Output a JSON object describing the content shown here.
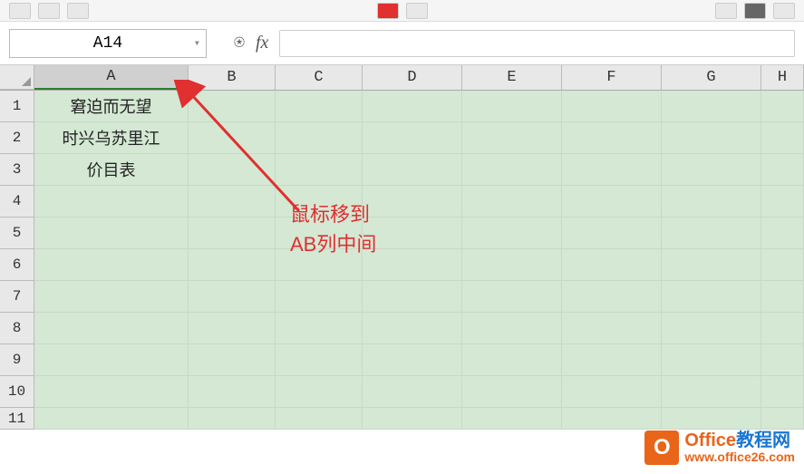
{
  "namebox": {
    "value": "A14"
  },
  "formula_bar": {
    "fx_label": "fx",
    "value": ""
  },
  "columns": [
    "A",
    "B",
    "C",
    "D",
    "E",
    "F",
    "G",
    "H"
  ],
  "rows": [
    "1",
    "2",
    "3",
    "4",
    "5",
    "6",
    "7",
    "8",
    "9",
    "10",
    "11"
  ],
  "cells": {
    "A1": "窘迫而无望",
    "A2": "时兴乌苏里江",
    "A3": "价目表"
  },
  "annotation": {
    "line1": "鼠标移到",
    "line2": "AB列中间"
  },
  "watermark": {
    "logo_letter": "O",
    "brand_en": "Office",
    "brand_cn": "教程网",
    "url": "www.office26.com"
  },
  "colors": {
    "cell_bg": "#d4e8d4",
    "annotation": "#e03030",
    "accent_orange": "#e8651a",
    "accent_blue": "#1976d2"
  }
}
